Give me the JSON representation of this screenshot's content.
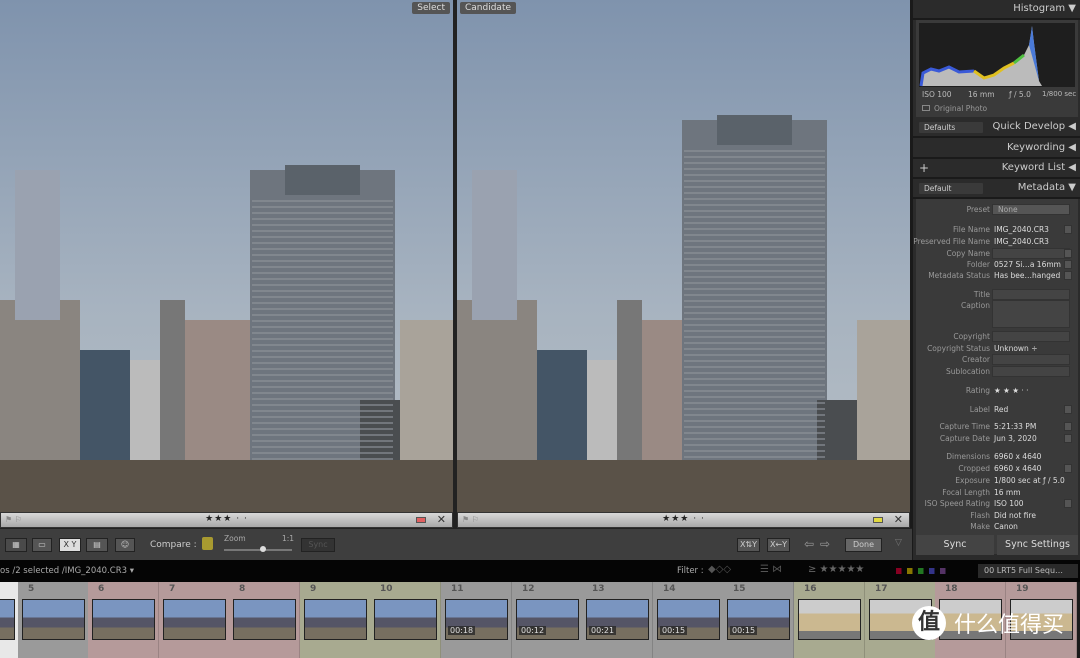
{
  "compare": {
    "select_label": "Select",
    "candidate_label": "Candidate",
    "select": {
      "rating": "★★★ · ·",
      "label_color": "#e06060"
    },
    "candidate": {
      "rating": "★★★ · ·",
      "label_color": "#e0d840"
    }
  },
  "toolbar": {
    "compare_label": "Compare :",
    "zoom_label": "Zoom",
    "zoom_ratio": "1:1",
    "zoom_level": 0.5,
    "sync_label": "Sync",
    "swap_label": "X⇅Y",
    "make_select_label": "X←Y",
    "done_label": "Done"
  },
  "histogram": {
    "title": "Histogram",
    "iso": "ISO 100",
    "focal": "16 mm",
    "aperture": "ƒ / 5.0",
    "shutter": "1/800 sec",
    "original_photo": "Original Photo"
  },
  "panels": {
    "quick_develop": "Quick Develop",
    "quick_develop_preset": "Defaults",
    "keywording": "Keywording",
    "keyword_list": "Keyword List",
    "metadata": "Metadata",
    "metadata_preset": "Default"
  },
  "metadata": {
    "preset_label": "Preset",
    "preset_value": "None",
    "rows": [
      {
        "k": "File Name",
        "v": "IMG_2040.CR3"
      },
      {
        "k": "Preserved File Name",
        "v": "IMG_2040.CR3"
      },
      {
        "k": "Copy Name",
        "v": ""
      },
      {
        "k": "Folder",
        "v": "0527 Si…a 16mm"
      },
      {
        "k": "Metadata Status",
        "v": "Has bee…hanged"
      },
      {
        "k": "Title",
        "v": ""
      },
      {
        "k": "Caption",
        "v": ""
      },
      {
        "k": "Copyright",
        "v": ""
      },
      {
        "k": "Copyright Status",
        "v": "Unknown ÷"
      },
      {
        "k": "Creator",
        "v": ""
      },
      {
        "k": "Sublocation",
        "v": ""
      },
      {
        "k": "Rating",
        "v": "★ ★ ★  ·  ·"
      },
      {
        "k": "Label",
        "v": "Red"
      },
      {
        "k": "Capture Time",
        "v": "5:21:33 PM"
      },
      {
        "k": "Capture Date",
        "v": "Jun 3, 2020"
      },
      {
        "k": "Dimensions",
        "v": "6960 x 4640"
      },
      {
        "k": "Cropped",
        "v": "6960 x 4640"
      },
      {
        "k": "Exposure",
        "v": "1/800 sec at ƒ / 5.0"
      },
      {
        "k": "Focal Length",
        "v": "16 mm"
      },
      {
        "k": "ISO Speed Rating",
        "v": "ISO 100"
      },
      {
        "k": "Flash",
        "v": "Did not fire"
      },
      {
        "k": "Make",
        "v": "Canon"
      }
    ]
  },
  "sync": {
    "sync_label": "Sync",
    "sync_settings_label": "Sync Settings"
  },
  "filmstrip": {
    "path": "os /2 selected /IMG_2040.CR3 ▾",
    "filter_label": "Filter :",
    "rating_filter": "≥ ★★★★★",
    "preset": "00 LRT5 Full Sequ…",
    "cells": [
      {
        "n": "",
        "color": "#e8e8e8",
        "scene": "city"
      },
      {
        "n": "5",
        "color": "#9a9a9a",
        "scene": "city"
      },
      {
        "n": "6",
        "color": "#b59a9a",
        "scene": "city"
      },
      {
        "n": "7",
        "color": "#b59a9a",
        "scene": "city"
      },
      {
        "n": "8",
        "color": "#b59a9a",
        "scene": "city"
      },
      {
        "n": "9",
        "color": "#a8aa90",
        "scene": "city"
      },
      {
        "n": "10",
        "color": "#a8aa90",
        "scene": "city"
      },
      {
        "n": "11",
        "color": "#9a9a9a",
        "scene": "city",
        "dur": "00:18"
      },
      {
        "n": "12",
        "color": "#9a9a9a",
        "scene": "city",
        "dur": "00:12"
      },
      {
        "n": "13",
        "color": "#9a9a9a",
        "scene": "city",
        "dur": "00:21"
      },
      {
        "n": "14",
        "color": "#9a9a9a",
        "scene": "city",
        "dur": "00:15"
      },
      {
        "n": "15",
        "color": "#9a9a9a",
        "scene": "city",
        "dur": "00:15"
      },
      {
        "n": "16",
        "color": "#a8aa90",
        "scene": "gate"
      },
      {
        "n": "17",
        "color": "#a8aa90",
        "scene": "gate"
      },
      {
        "n": "18",
        "color": "#b59a9a",
        "scene": "gate"
      },
      {
        "n": "19",
        "color": "#b59a9a",
        "scene": "gate"
      }
    ]
  },
  "watermark": {
    "logo_char": "值",
    "text": "什么值得买"
  }
}
